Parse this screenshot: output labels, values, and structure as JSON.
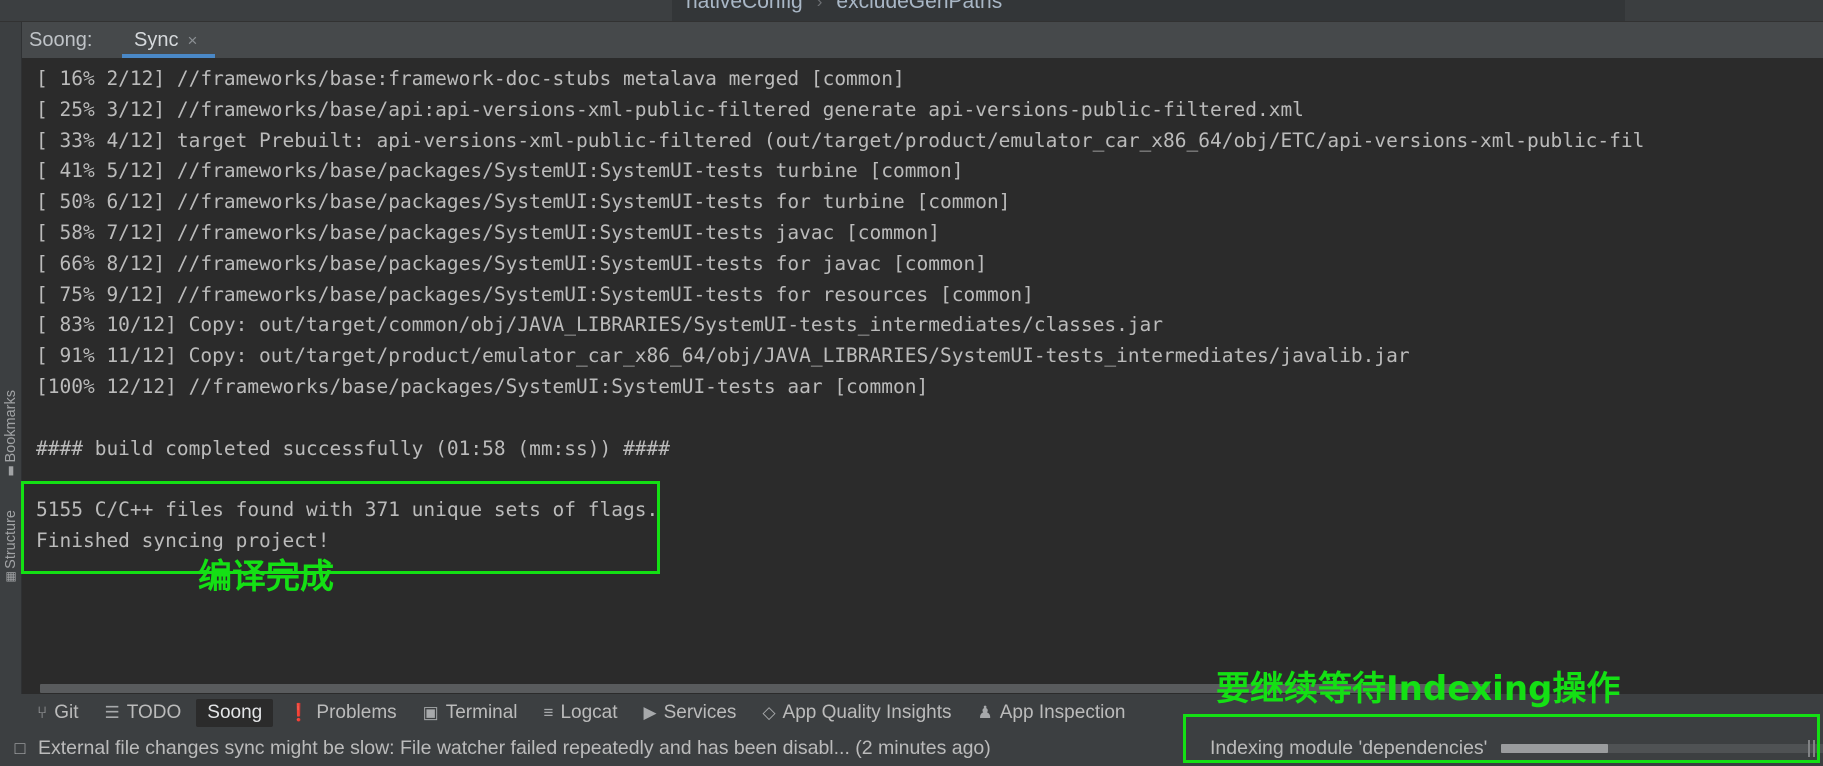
{
  "breadcrumb": {
    "items": [
      "nativeConfig",
      "excludeGenPaths"
    ],
    "separator": "›"
  },
  "rail": {
    "bookmarks_label": "Bookmarks",
    "bookmarks_icon": "bookmark-icon",
    "structure_label": "Structure",
    "structure_icon": "structure-icon"
  },
  "tabbar": {
    "title": "Soong:",
    "tab_label": "Sync",
    "close_glyph": "×"
  },
  "console": {
    "lines": [
      "[ 16% 2/12] //frameworks/base:framework-doc-stubs metalava merged [common]",
      "[ 25% 3/12] //frameworks/base/api:api-versions-xml-public-filtered generate api-versions-public-filtered.xml",
      "[ 33% 4/12] target Prebuilt: api-versions-xml-public-filtered (out/target/product/emulator_car_x86_64/obj/ETC/api-versions-xml-public-fil",
      "[ 41% 5/12] //frameworks/base/packages/SystemUI:SystemUI-tests turbine [common]",
      "[ 50% 6/12] //frameworks/base/packages/SystemUI:SystemUI-tests for turbine [common]",
      "[ 58% 7/12] //frameworks/base/packages/SystemUI:SystemUI-tests javac [common]",
      "[ 66% 8/12] //frameworks/base/packages/SystemUI:SystemUI-tests for javac [common]",
      "[ 75% 9/12] //frameworks/base/packages/SystemUI:SystemUI-tests for resources [common]",
      "[ 83% 10/12] Copy: out/target/common/obj/JAVA_LIBRARIES/SystemUI-tests_intermediates/classes.jar",
      "[ 91% 11/12] Copy: out/target/product/emulator_car_x86_64/obj/JAVA_LIBRARIES/SystemUI-tests_intermediates/javalib.jar",
      "[100% 12/12] //frameworks/base/packages/SystemUI:SystemUI-tests aar [common]",
      "",
      "#### build completed successfully (01:58 (mm:ss)) ####",
      "",
      "5155 C/C++ files found with 371 unique sets of flags.",
      "Finished syncing project!"
    ]
  },
  "bottom_bar": {
    "items": [
      {
        "label": "Git",
        "icon": "git-branch-icon",
        "glyph": "⑂",
        "active": false
      },
      {
        "label": "TODO",
        "icon": "todo-list-icon",
        "glyph": "☰",
        "active": false
      },
      {
        "label": "Soong",
        "icon": "",
        "glyph": "",
        "active": true
      },
      {
        "label": "Problems",
        "icon": "warning-info-icon",
        "glyph": "❗",
        "active": false
      },
      {
        "label": "Terminal",
        "icon": "terminal-icon",
        "glyph": "▣",
        "active": false
      },
      {
        "label": "Logcat",
        "icon": "logcat-icon",
        "glyph": "≡",
        "active": false
      },
      {
        "label": "Services",
        "icon": "services-play-icon",
        "glyph": "▶",
        "active": false
      },
      {
        "label": "App Quality Insights",
        "icon": "diamond-icon",
        "glyph": "◇",
        "active": false
      },
      {
        "label": "App Inspection",
        "icon": "inspection-icon",
        "glyph": "♟",
        "active": false
      }
    ]
  },
  "status_bar": {
    "icon": "notification-icon",
    "icon_glyph": "□",
    "message": "External file changes sync might be slow: File watcher failed repeatedly and has been disabl... (2 minutes ago)",
    "indexing_text": "Indexing module 'dependencies'",
    "progress_percent": 30
  },
  "annotations": {
    "build_note": "编译完成",
    "indexing_note": "要继续等待Indexing操作",
    "color": "#14e014"
  }
}
